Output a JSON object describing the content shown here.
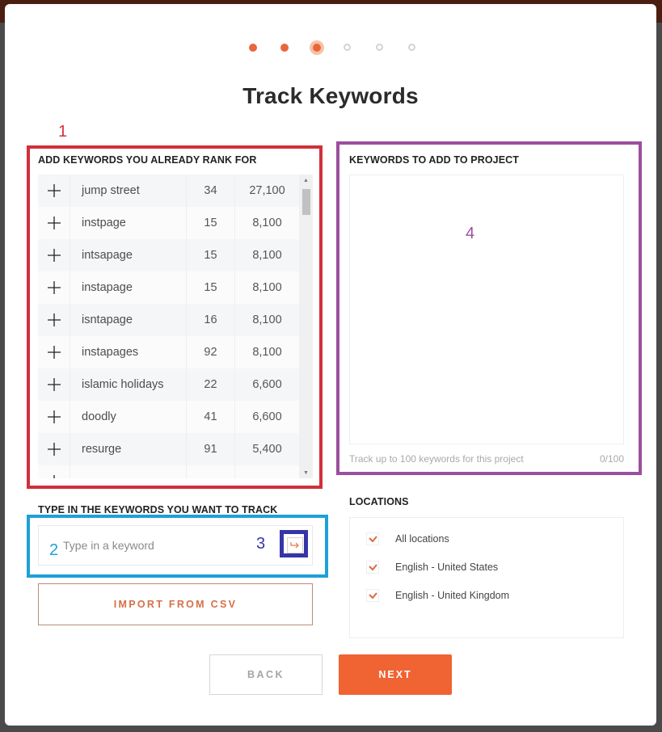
{
  "stepper": {
    "total_steps": 6,
    "current_step": 3,
    "steps": [
      {
        "state": "done"
      },
      {
        "state": "done"
      },
      {
        "state": "current"
      },
      {
        "state": "todo"
      },
      {
        "state": "todo"
      },
      {
        "state": "todo"
      }
    ]
  },
  "page_title": "Track Keywords",
  "annotations": {
    "num1": "1",
    "num2": "2",
    "num3": "3",
    "num4": "4",
    "colors": {
      "box1": "#d0303a",
      "box2": "#1ea0d8",
      "box3": "#3535a8",
      "box4": "#9b4f9f"
    }
  },
  "ranked_keywords": {
    "label": "ADD KEYWORDS YOU ALREADY RANK FOR",
    "add_icon": "plus-icon",
    "rows": [
      {
        "keyword": "jump street",
        "rank": "34",
        "volume": "27,100"
      },
      {
        "keyword": "instpage",
        "rank": "15",
        "volume": "8,100"
      },
      {
        "keyword": "intsapage",
        "rank": "15",
        "volume": "8,100"
      },
      {
        "keyword": "instapage",
        "rank": "15",
        "volume": "8,100"
      },
      {
        "keyword": "isntapage",
        "rank": "16",
        "volume": "8,100"
      },
      {
        "keyword": "instapages",
        "rank": "92",
        "volume": "8,100"
      },
      {
        "keyword": "islamic holidays",
        "rank": "22",
        "volume": "6,600"
      },
      {
        "keyword": "doodly",
        "rank": "41",
        "volume": "6,600"
      },
      {
        "keyword": "resurge",
        "rank": "91",
        "volume": "5,400"
      },
      {
        "keyword": "",
        "rank": "",
        "volume": ""
      }
    ]
  },
  "type_keywords": {
    "label": "TYPE IN THE KEYWORDS YOU WANT TO TRACK",
    "input_value": "",
    "input_placeholder": "Type in a keyword",
    "submit_icon": "enter-arrow-icon"
  },
  "import_button": "IMPORT FROM CSV",
  "project_keywords": {
    "label": "KEYWORDS TO ADD TO PROJECT",
    "hint": "Track up to 100 keywords for this project",
    "count": "0/100"
  },
  "locations": {
    "label": "LOCATIONS",
    "items": [
      {
        "label": "All locations",
        "checked": true
      },
      {
        "label": "English - United States",
        "checked": true
      },
      {
        "label": "English - United Kingdom",
        "checked": true
      }
    ]
  },
  "footer": {
    "back_label": "BACK",
    "next_label": "NEXT"
  },
  "colors": {
    "accent": "#f06332",
    "step_done": "#e8673a"
  }
}
